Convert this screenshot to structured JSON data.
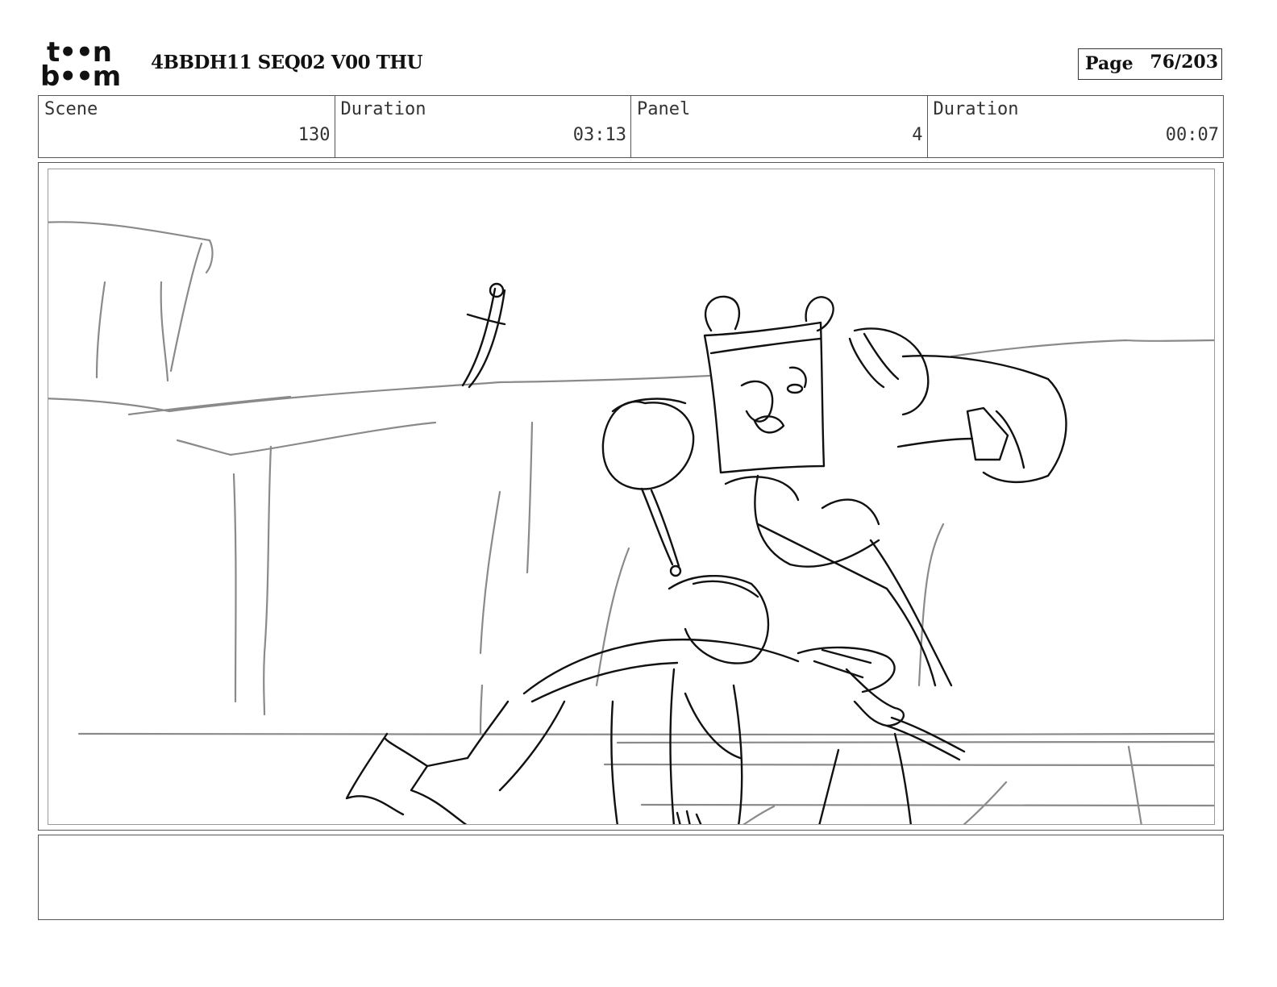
{
  "header": {
    "logo_line1": "t••n",
    "logo_line2": "b••m",
    "document_title": "4BBDH11 SEQ02 V00 THU",
    "page_label": "Page",
    "page_number": "76/203"
  },
  "info": {
    "scene_label": "Scene",
    "scene_value": "130",
    "scene_duration_label": "Duration",
    "scene_duration_value": "03:13",
    "panel_label": "Panel",
    "panel_value": "4",
    "panel_duration_label": "Duration",
    "panel_duration_value": "00:07"
  },
  "panel_image": {
    "icon": "storyboard-sketch",
    "subject": "rough pencil sketch of a large armored character with an eye patch grabbing a smaller character, sword stuck in the ledge behind"
  },
  "notes": {
    "text": ""
  }
}
